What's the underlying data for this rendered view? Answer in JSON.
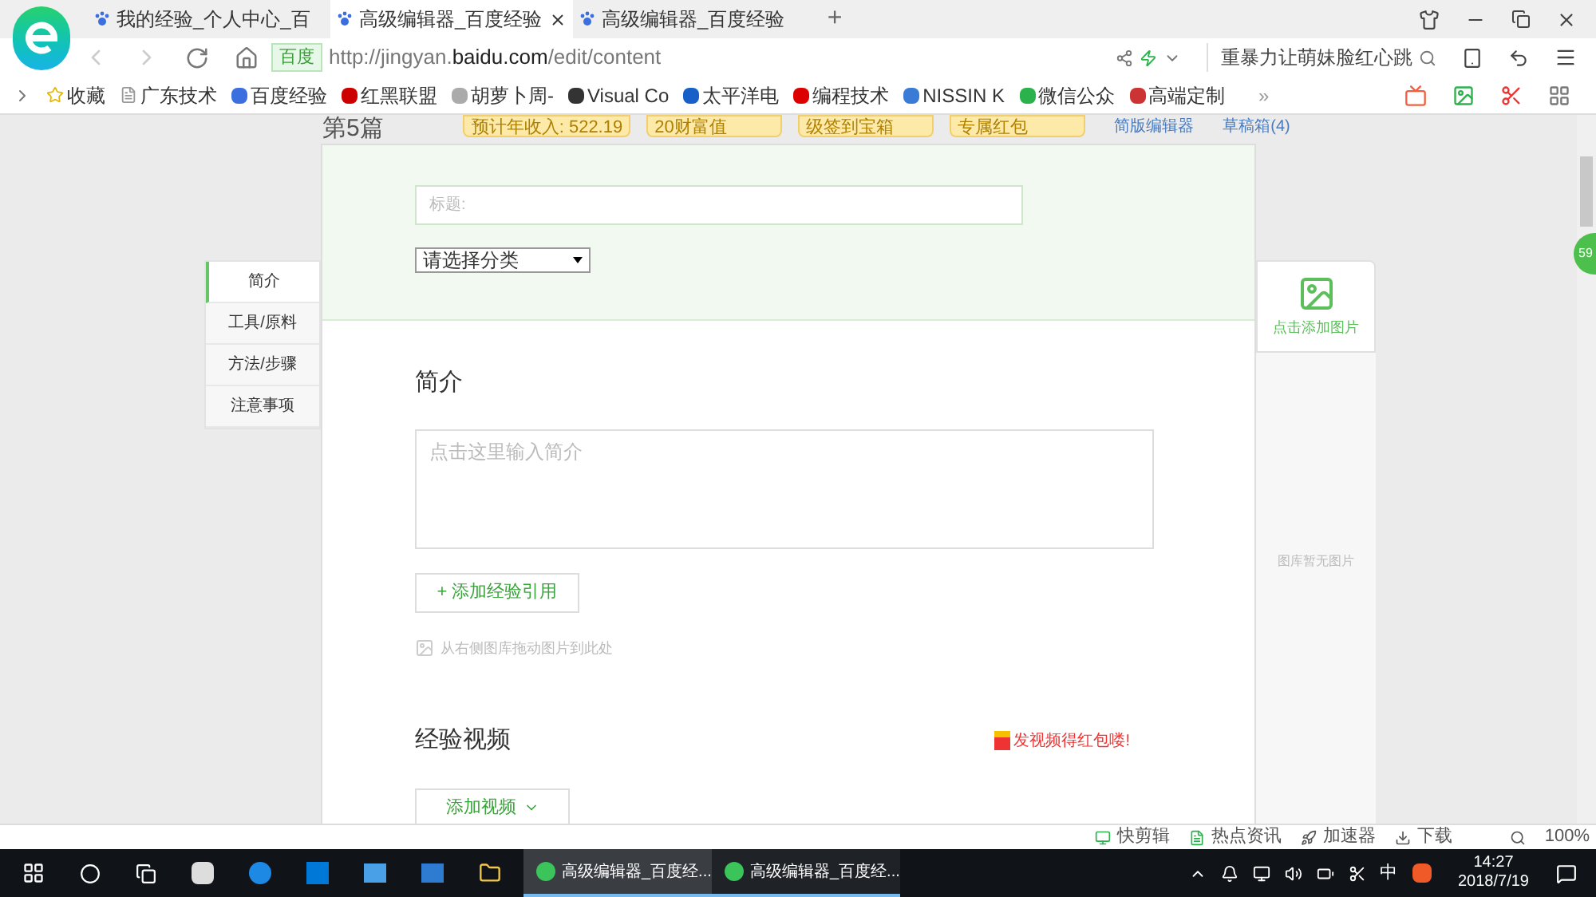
{
  "tabs": [
    {
      "label": "我的经验_个人中心_百",
      "selected": false
    },
    {
      "label": "高级编辑器_百度经验",
      "selected": true
    },
    {
      "label": "高级编辑器_百度经验",
      "selected": false
    }
  ],
  "new_tab": "+",
  "address": {
    "badge": "百度",
    "url_prefix": "http://jingyan.",
    "url_host": "baidu.com",
    "url_path": "/edit/content",
    "search": "重暴力让萌妹脸红心跳"
  },
  "bookmarks": [
    "收藏",
    "广东技术",
    "百度经验",
    "红黑联盟",
    "胡萝卜周-",
    "Visual Co",
    "太平洋电",
    "编程技术",
    "NISSIN K",
    "微信公众",
    "高端定制"
  ],
  "bookmarks_more": "»",
  "top_strip": {
    "article_no": "第5篇",
    "badges": [
      "预计年收入: 522.19",
      "20财富值",
      "级签到宝箱",
      "专属红包"
    ],
    "links": [
      "简版编辑器",
      "草稿箱(4)"
    ]
  },
  "editor": {
    "title_placeholder": "标题:",
    "category": "请选择分类",
    "intro_heading": "简介",
    "intro_placeholder": "点击这里输入简介",
    "add_ref": "+ 添加经验引用",
    "drag_hint": "从右侧图库拖动图片到此处",
    "video_heading": "经验视频",
    "video_promo": "发视频得红包喽!",
    "add_video": "添加视频"
  },
  "nav": [
    {
      "label": "简介",
      "selected": true
    },
    {
      "label": "工具/原料",
      "selected": false
    },
    {
      "label": "方法/步骤",
      "selected": false
    },
    {
      "label": "注意事项",
      "selected": false
    }
  ],
  "gallery": {
    "add": "点击添加图片",
    "empty": "图库暂无图片"
  },
  "floating_badge": "59",
  "status_bar": {
    "items": [
      "快剪辑",
      "热点资讯",
      "加速器",
      "下载"
    ],
    "zoom": "100%"
  },
  "taskbar": {
    "windows": [
      {
        "label": "高级编辑器_百度经...",
        "selected": true
      },
      {
        "label": "高级编辑器_百度经...",
        "selected": false
      }
    ],
    "ime": "中",
    "time": "14:27",
    "date": "2018/7/19"
  }
}
